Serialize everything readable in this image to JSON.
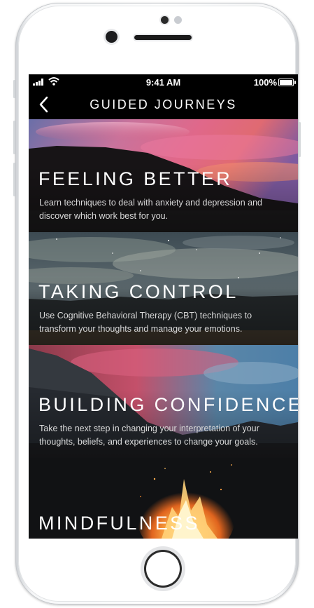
{
  "status_bar": {
    "time": "9:41 AM",
    "battery": "100%"
  },
  "nav": {
    "title": "GUIDED JOURNEYS"
  },
  "journeys": [
    {
      "title": "FEELING BETTER",
      "description": "Learn techniques to deal with anxiety and depression and discover which work best for you."
    },
    {
      "title": "TAKING CONTROL",
      "description": "Use Cognitive Behavioral Therapy (CBT) techniques to transform your thoughts and manage your emotions."
    },
    {
      "title": "BUILDING CONFIDENCE",
      "description": "Take the next step in changing your interpretation of your thoughts, beliefs, and experiences to change your goals."
    },
    {
      "title": "MINDFULNESS",
      "description": ""
    }
  ]
}
